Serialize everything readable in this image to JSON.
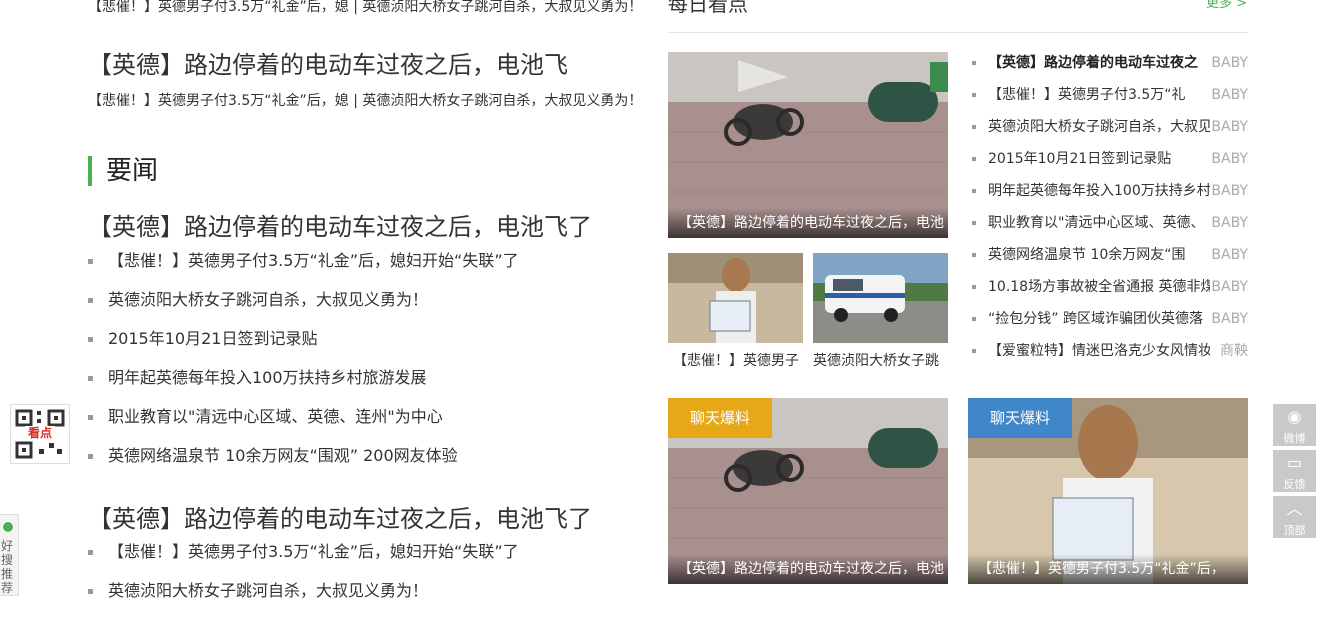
{
  "left": {
    "top_ticker": "【悲催！】英德男子付3.5万“礼金”后，媳  |  英德浈阳大桥女子跳河自杀，大叔见义勇为！",
    "headline_1": "【英德】路边停着的电动车过夜之后，电池飞",
    "ticker_2": "【悲催！】英德男子付3.5万“礼金”后，媳  |  英德浈阳大桥女子跳河自杀，大叔见义勇为！",
    "section_title": "要闻",
    "headline_2": "【英德】路边停着的电动车过夜之后，电池飞了",
    "list_1": [
      "【悲催！】英德男子付3.5万“礼金”后，媳妇开始“失联”了",
      "英德浈阳大桥女子跳河自杀，大叔见义勇为！",
      "2015年10月21日签到记录贴",
      "明年起英德每年投入100万扶持乡村旅游发展",
      "职业教育以\"清远中心区域、英德、连州\"为中心",
      "英德网络温泉节 10余万网友“围观” 200网友体验"
    ],
    "headline_3": "【英德】路边停着的电动车过夜之后，电池飞了",
    "list_2": [
      "【悲催！】英德男子付3.5万“礼金”后，媳妇开始“失联”了",
      "英德浈阳大桥女子跳河自杀，大叔见义勇为！"
    ]
  },
  "float": {
    "qr_label": "看点",
    "hot_text": "好搜推荐"
  },
  "right": {
    "title": "每日看点",
    "more": "更多 >",
    "main_photo_caption": "【英德】路边停着的电动车过夜之后，电池",
    "thumbs": [
      {
        "caption": "【悲催！】英德男子"
      },
      {
        "caption": "英德浈阳大桥女子跳"
      }
    ],
    "list": [
      {
        "title": "【英德】路边停着的电动车过夜之",
        "source": "BABY"
      },
      {
        "title": "【悲催！】英德男子付3.5万“礼",
        "source": "BABY"
      },
      {
        "title": "英德浈阳大桥女子跳河自杀，大叔见",
        "source": "BABY"
      },
      {
        "title": "2015年10月21日签到记录贴",
        "source": "BABY"
      },
      {
        "title": "明年起英德每年投入100万扶持乡村",
        "source": "BABY"
      },
      {
        "title": "职业教育以\"清远中心区域、英德、",
        "source": "BABY"
      },
      {
        "title": "英德网络温泉节 10余万网友“围",
        "source": "BABY"
      },
      {
        "title": "10.18场方事故被全省通报 英德非煤",
        "source": "BABY"
      },
      {
        "title": "“捡包分钱” 跨区域诈骗团伙英德落",
        "source": "BABY"
      },
      {
        "title": "【爱蜜粒特】情迷巴洛克少女风情妆",
        "source": "商鞅"
      }
    ],
    "cards": [
      {
        "badge": "聊天爆料",
        "badge_color": "#e6a817",
        "caption": "【英德】路边停着的电动车过夜之后，电池"
      },
      {
        "badge": "聊天爆料",
        "badge_color": "#3f87c9",
        "caption": "【悲催！】英德男子付3.5万“礼金”后，"
      }
    ]
  },
  "toolbar": {
    "weibo": "微博",
    "feedback": "反馈",
    "top": "顶部"
  }
}
